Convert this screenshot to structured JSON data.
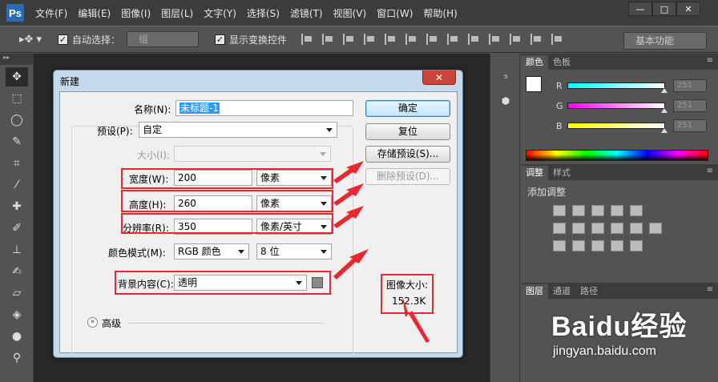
{
  "menubar": {
    "logo": "Ps",
    "items": [
      "文件(F)",
      "编辑(E)",
      "图像(I)",
      "图层(L)",
      "文字(Y)",
      "选择(S)",
      "滤镜(T)",
      "视图(V)",
      "窗口(W)",
      "帮助(H)"
    ],
    "window_controls": [
      "—",
      "□",
      "✕"
    ]
  },
  "optionsbar": {
    "tool_glyph": "▸✥ ▾",
    "auto_select_label": "自动选择：",
    "auto_select_checked": true,
    "auto_select_value": "组",
    "show_transform_label": "显示变换控件",
    "show_transform_checked": true,
    "workspace": "基本功能"
  },
  "panels": {
    "color_tabs": [
      "颜色",
      "色板"
    ],
    "rgb": [
      {
        "label": "R",
        "value": "251",
        "gradient": "linear-gradient(to right,#00ffff,#ffffff)"
      },
      {
        "label": "G",
        "value": "251",
        "gradient": "linear-gradient(to right,#ff00ff,#ffffff)"
      },
      {
        "label": "B",
        "value": "251",
        "gradient": "linear-gradient(to right,#ffff00,#ffffff)"
      }
    ],
    "adjust_tabs": [
      "调整",
      "样式"
    ],
    "adjust_title": "添加调整",
    "layer_tabs": [
      "图层",
      "通道",
      "路径"
    ]
  },
  "dialog": {
    "title": "新建",
    "name_label": "名称(N):",
    "name_value": "未标题-1",
    "preset_label": "预设(P):",
    "preset_value": "自定",
    "size_label": "大小(I):",
    "width_label": "宽度(W):",
    "width_value": "200",
    "width_unit": "像素",
    "height_label": "高度(H):",
    "height_value": "260",
    "height_unit": "像素",
    "resolution_label": "分辨率(R):",
    "resolution_value": "350",
    "resolution_unit": "像素/英寸",
    "color_mode_label": "颜色模式(M):",
    "color_mode_value": "RGB 颜色",
    "bit_depth": "8 位",
    "background_label": "背景内容(C):",
    "background_value": "透明",
    "advanced_label": "高级",
    "ok_button": "确定",
    "reset_button": "复位",
    "save_preset_button": "存储预设(S)...",
    "delete_preset_button": "删除预设(D)...",
    "image_size_label": "图像大小:",
    "image_size_value": "152.3K"
  },
  "watermark": {
    "main": "Baidu经验",
    "sub": "jingyan.baidu.com"
  },
  "colors": {
    "annotation_red": "#e8282c",
    "dialog_frame": "#c5d9ec",
    "ok_button_blue": "#bee6fd"
  }
}
